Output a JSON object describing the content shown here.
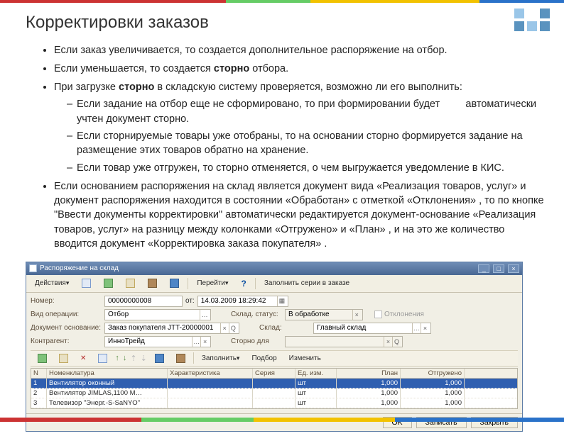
{
  "slide": {
    "title": "Корректировки заказов",
    "bullets": [
      "Если заказ увеличивается, то создается дополнительное распоряжение на отбор.",
      "Если уменьшается, то создается сторно отбора.",
      "При загрузке сторно в складскую систему проверяется, возможно ли его выполнить:",
      "Если основанием распоряжения на склад является документ вида «Реализация товаров, услуг» и документ распоряжения находится в состоянии «Обработан» с отметкой «Отклонения» , то по кнопке \"Ввести документы корректировки\" автоматически редактируется документ-основание «Реализация товаров, услуг» на разницу между колонками «Отгружено» и «План» , и на это же количество вводится документ «Корректировка заказа покупателя» ."
    ],
    "bullet2_strong": "сторно",
    "bullet3_strong": "сторно",
    "sub_bullets": [
      "Если задание на отбор еще не сформировано, то при формировании будет         автоматически учтен документ сторно.",
      "Если сторнируемые товары уже отобраны, то на основании сторно формируется задание на размещение этих товаров обратно на хранение.",
      "Если товар уже отгружен, то сторно отменяется, о чем выгружается уведомление в КИС."
    ]
  },
  "window": {
    "title": "Распоряжение на склад",
    "toolbar": {
      "actions": "Действия",
      "go": "Перейти",
      "fill": "Заполнить серии в заказе"
    },
    "form": {
      "number_label": "Номер:",
      "number_value": "00000000008",
      "date_prefix": "от:",
      "date_value": "14.03.2009 18:29:42",
      "optype_label": "Вид операции:",
      "optype_value": "Отбор",
      "status_label": "Склад. статус:",
      "status_value": "В обработке",
      "deviations_label": "Отклонения",
      "docbase_label": "Документ основание:",
      "docbase_value": "Заказ покупателя JTT-20000001",
      "warehouse_label": "Склад:",
      "warehouse_value": "Главный склад",
      "contr_label": "Контрагент:",
      "contr_value": "ИнноТрейд",
      "storno_label": "Сторно для"
    },
    "subtoolbar": {
      "fill": "Заполнить",
      "pick": "Подбор",
      "change": "Изменить"
    },
    "grid": {
      "headers": {
        "n": "N",
        "nom": "Номенклатура",
        "har": "Характеристика",
        "ser": "Серия",
        "ed": "Ед. изм.",
        "pla": "План",
        "ot": "Отгружено"
      },
      "rows": [
        {
          "n": "1",
          "nom": "Вентилятор оконный",
          "har": "",
          "ser": "",
          "ed": "шт",
          "pla": "1,000",
          "ot": "1,000"
        },
        {
          "n": "2",
          "nom": "Вентилятор JIMLAS,1100 М…",
          "har": "",
          "ser": "",
          "ed": "шт",
          "pla": "1,000",
          "ot": "1,000"
        },
        {
          "n": "3",
          "nom": "Телевизор \"Энерг.-S-SaNYO\"",
          "har": "",
          "ser": "",
          "ed": "шт",
          "pla": "1,000",
          "ot": "1,000"
        }
      ]
    },
    "footer": {
      "ok": "OK",
      "save": "Записать",
      "close": "Закрыть"
    }
  }
}
